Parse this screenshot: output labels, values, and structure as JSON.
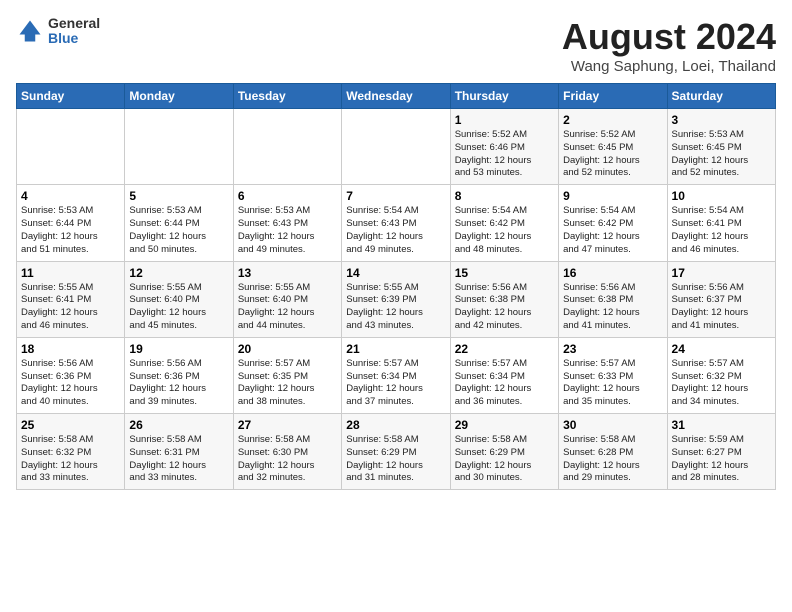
{
  "header": {
    "logo_line1": "General",
    "logo_line2": "Blue",
    "title": "August 2024",
    "subtitle": "Wang Saphung, Loei, Thailand"
  },
  "weekdays": [
    "Sunday",
    "Monday",
    "Tuesday",
    "Wednesday",
    "Thursday",
    "Friday",
    "Saturday"
  ],
  "weeks": [
    [
      {
        "day": "",
        "info": ""
      },
      {
        "day": "",
        "info": ""
      },
      {
        "day": "",
        "info": ""
      },
      {
        "day": "",
        "info": ""
      },
      {
        "day": "1",
        "info": "Sunrise: 5:52 AM\nSunset: 6:46 PM\nDaylight: 12 hours\nand 53 minutes."
      },
      {
        "day": "2",
        "info": "Sunrise: 5:52 AM\nSunset: 6:45 PM\nDaylight: 12 hours\nand 52 minutes."
      },
      {
        "day": "3",
        "info": "Sunrise: 5:53 AM\nSunset: 6:45 PM\nDaylight: 12 hours\nand 52 minutes."
      }
    ],
    [
      {
        "day": "4",
        "info": "Sunrise: 5:53 AM\nSunset: 6:44 PM\nDaylight: 12 hours\nand 51 minutes."
      },
      {
        "day": "5",
        "info": "Sunrise: 5:53 AM\nSunset: 6:44 PM\nDaylight: 12 hours\nand 50 minutes."
      },
      {
        "day": "6",
        "info": "Sunrise: 5:53 AM\nSunset: 6:43 PM\nDaylight: 12 hours\nand 49 minutes."
      },
      {
        "day": "7",
        "info": "Sunrise: 5:54 AM\nSunset: 6:43 PM\nDaylight: 12 hours\nand 49 minutes."
      },
      {
        "day": "8",
        "info": "Sunrise: 5:54 AM\nSunset: 6:42 PM\nDaylight: 12 hours\nand 48 minutes."
      },
      {
        "day": "9",
        "info": "Sunrise: 5:54 AM\nSunset: 6:42 PM\nDaylight: 12 hours\nand 47 minutes."
      },
      {
        "day": "10",
        "info": "Sunrise: 5:54 AM\nSunset: 6:41 PM\nDaylight: 12 hours\nand 46 minutes."
      }
    ],
    [
      {
        "day": "11",
        "info": "Sunrise: 5:55 AM\nSunset: 6:41 PM\nDaylight: 12 hours\nand 46 minutes."
      },
      {
        "day": "12",
        "info": "Sunrise: 5:55 AM\nSunset: 6:40 PM\nDaylight: 12 hours\nand 45 minutes."
      },
      {
        "day": "13",
        "info": "Sunrise: 5:55 AM\nSunset: 6:40 PM\nDaylight: 12 hours\nand 44 minutes."
      },
      {
        "day": "14",
        "info": "Sunrise: 5:55 AM\nSunset: 6:39 PM\nDaylight: 12 hours\nand 43 minutes."
      },
      {
        "day": "15",
        "info": "Sunrise: 5:56 AM\nSunset: 6:38 PM\nDaylight: 12 hours\nand 42 minutes."
      },
      {
        "day": "16",
        "info": "Sunrise: 5:56 AM\nSunset: 6:38 PM\nDaylight: 12 hours\nand 41 minutes."
      },
      {
        "day": "17",
        "info": "Sunrise: 5:56 AM\nSunset: 6:37 PM\nDaylight: 12 hours\nand 41 minutes."
      }
    ],
    [
      {
        "day": "18",
        "info": "Sunrise: 5:56 AM\nSunset: 6:36 PM\nDaylight: 12 hours\nand 40 minutes."
      },
      {
        "day": "19",
        "info": "Sunrise: 5:56 AM\nSunset: 6:36 PM\nDaylight: 12 hours\nand 39 minutes."
      },
      {
        "day": "20",
        "info": "Sunrise: 5:57 AM\nSunset: 6:35 PM\nDaylight: 12 hours\nand 38 minutes."
      },
      {
        "day": "21",
        "info": "Sunrise: 5:57 AM\nSunset: 6:34 PM\nDaylight: 12 hours\nand 37 minutes."
      },
      {
        "day": "22",
        "info": "Sunrise: 5:57 AM\nSunset: 6:34 PM\nDaylight: 12 hours\nand 36 minutes."
      },
      {
        "day": "23",
        "info": "Sunrise: 5:57 AM\nSunset: 6:33 PM\nDaylight: 12 hours\nand 35 minutes."
      },
      {
        "day": "24",
        "info": "Sunrise: 5:57 AM\nSunset: 6:32 PM\nDaylight: 12 hours\nand 34 minutes."
      }
    ],
    [
      {
        "day": "25",
        "info": "Sunrise: 5:58 AM\nSunset: 6:32 PM\nDaylight: 12 hours\nand 33 minutes."
      },
      {
        "day": "26",
        "info": "Sunrise: 5:58 AM\nSunset: 6:31 PM\nDaylight: 12 hours\nand 33 minutes."
      },
      {
        "day": "27",
        "info": "Sunrise: 5:58 AM\nSunset: 6:30 PM\nDaylight: 12 hours\nand 32 minutes."
      },
      {
        "day": "28",
        "info": "Sunrise: 5:58 AM\nSunset: 6:29 PM\nDaylight: 12 hours\nand 31 minutes."
      },
      {
        "day": "29",
        "info": "Sunrise: 5:58 AM\nSunset: 6:29 PM\nDaylight: 12 hours\nand 30 minutes."
      },
      {
        "day": "30",
        "info": "Sunrise: 5:58 AM\nSunset: 6:28 PM\nDaylight: 12 hours\nand 29 minutes."
      },
      {
        "day": "31",
        "info": "Sunrise: 5:59 AM\nSunset: 6:27 PM\nDaylight: 12 hours\nand 28 minutes."
      }
    ]
  ]
}
